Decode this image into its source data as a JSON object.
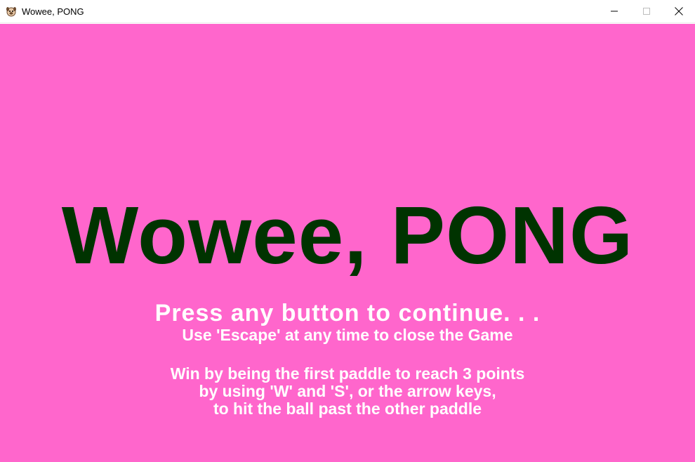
{
  "window": {
    "title": "Wowee, PONG",
    "app_icon": "pug-icon",
    "controls": [
      "minimize-icon",
      "maximize-icon",
      "close-icon"
    ]
  },
  "game": {
    "background_color": "#ff66cc",
    "title": "Wowee, PONG",
    "title_color": "#003300",
    "text_color": "#ffffff",
    "prompt": "Press any button to continue. . .",
    "escape_hint": "Use 'Escape' at any time to close the Game",
    "rules": [
      "Win by being the first paddle to reach 3 points",
      "by using 'W' and 'S', or the arrow keys,",
      "to hit the ball past the other paddle"
    ]
  }
}
